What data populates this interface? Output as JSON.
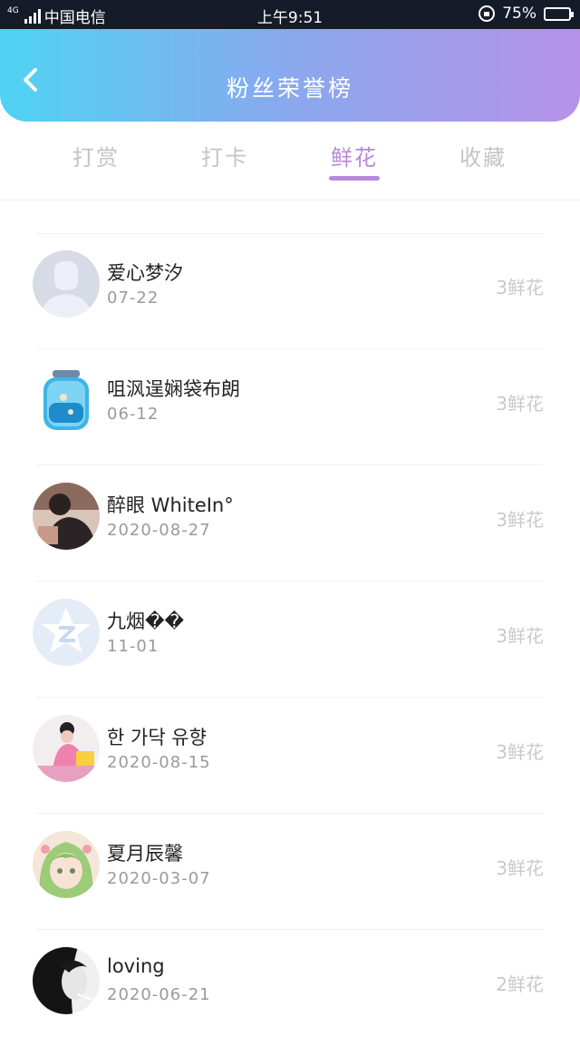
{
  "status_bar": {
    "network": "4G",
    "carrier": "中国电信",
    "time": "上午9:51",
    "battery": "75%",
    "battery_level": 0.75
  },
  "header": {
    "title": "粉丝荣誉榜",
    "back_icon": "chevron-left-icon"
  },
  "tabs": [
    {
      "label": "打赏",
      "active": false
    },
    {
      "label": "打卡",
      "active": false
    },
    {
      "label": "鲜花",
      "active": true
    },
    {
      "label": "收藏",
      "active": false
    }
  ],
  "colors": {
    "header_gradient": [
      "#4fd3f4",
      "#b692e8"
    ],
    "accent": "#b68ad8"
  },
  "fans": [
    {
      "name": "爱心梦汐",
      "date": "07-22",
      "count": "3鲜花",
      "avatar": "default-person-avatar"
    },
    {
      "name": "咀沨逞娴袋布朗",
      "date": "06-12",
      "count": "3鲜花",
      "avatar": "glass-jar-avatar"
    },
    {
      "name": "醉眼 WhiteIn°",
      "date": "2020-08-27",
      "count": "3鲜花",
      "avatar": "photo-avatar"
    },
    {
      "name": "九烟��",
      "date": "11-01",
      "count": "3鲜花",
      "avatar": "qq-star-avatar"
    },
    {
      "name": "한 가닥 유향",
      "date": "2020-08-15",
      "count": "3鲜花",
      "avatar": "photo-avatar"
    },
    {
      "name": "夏月辰馨",
      "date": "2020-03-07",
      "count": "3鲜花",
      "avatar": "anime-girl-avatar"
    },
    {
      "name": "loving",
      "date": "2020-06-21",
      "count": "2鲜花",
      "avatar": "bw-portrait-avatar"
    }
  ]
}
